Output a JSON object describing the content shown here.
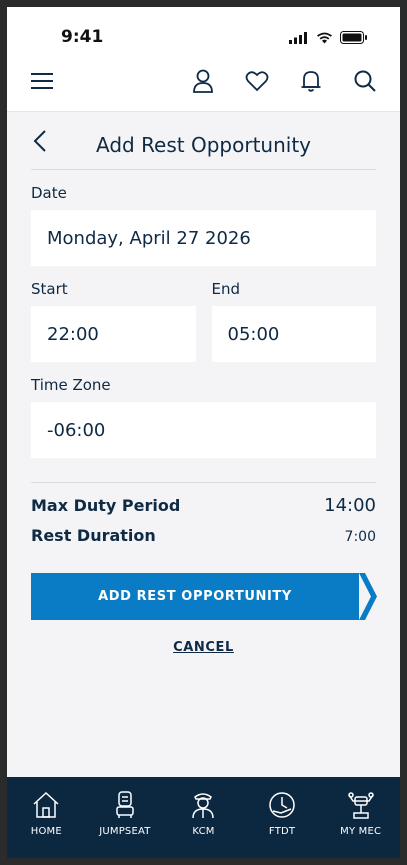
{
  "status": {
    "time": "9:41"
  },
  "appbar": {
    "icons": [
      "menu-icon",
      "profile-icon",
      "heart-icon",
      "bell-icon",
      "search-icon"
    ]
  },
  "page": {
    "title": "Add Rest Opportunity"
  },
  "form": {
    "date_label": "Date",
    "date_value": "Monday, April 27 2026",
    "start_label": "Start",
    "start_value": "22:00",
    "end_label": "End",
    "end_value": "05:00",
    "tz_label": "Time Zone",
    "tz_value": "-06:00"
  },
  "summary": {
    "max_duty_label": "Max Duty Period",
    "max_duty_value": "14:00",
    "rest_duration_label": "Rest Duration",
    "rest_duration_value": "7:00"
  },
  "actions": {
    "add_label": "ADD REST OPPORTUNITY",
    "cancel_label": "CANCEL"
  },
  "tabs": [
    {
      "label": "HOME",
      "icon": "home-icon"
    },
    {
      "label": "JUMPSEAT",
      "icon": "jumpseat-icon"
    },
    {
      "label": "KCM",
      "icon": "pilot-icon"
    },
    {
      "label": "FTDT",
      "icon": "clock-plane-icon"
    },
    {
      "label": "MY MEC",
      "icon": "cockpit-icon"
    }
  ],
  "colors": {
    "primary": "#0a7cc6",
    "navy": "#0c2740",
    "text": "#0f2a44",
    "background": "#f4f4f6"
  }
}
